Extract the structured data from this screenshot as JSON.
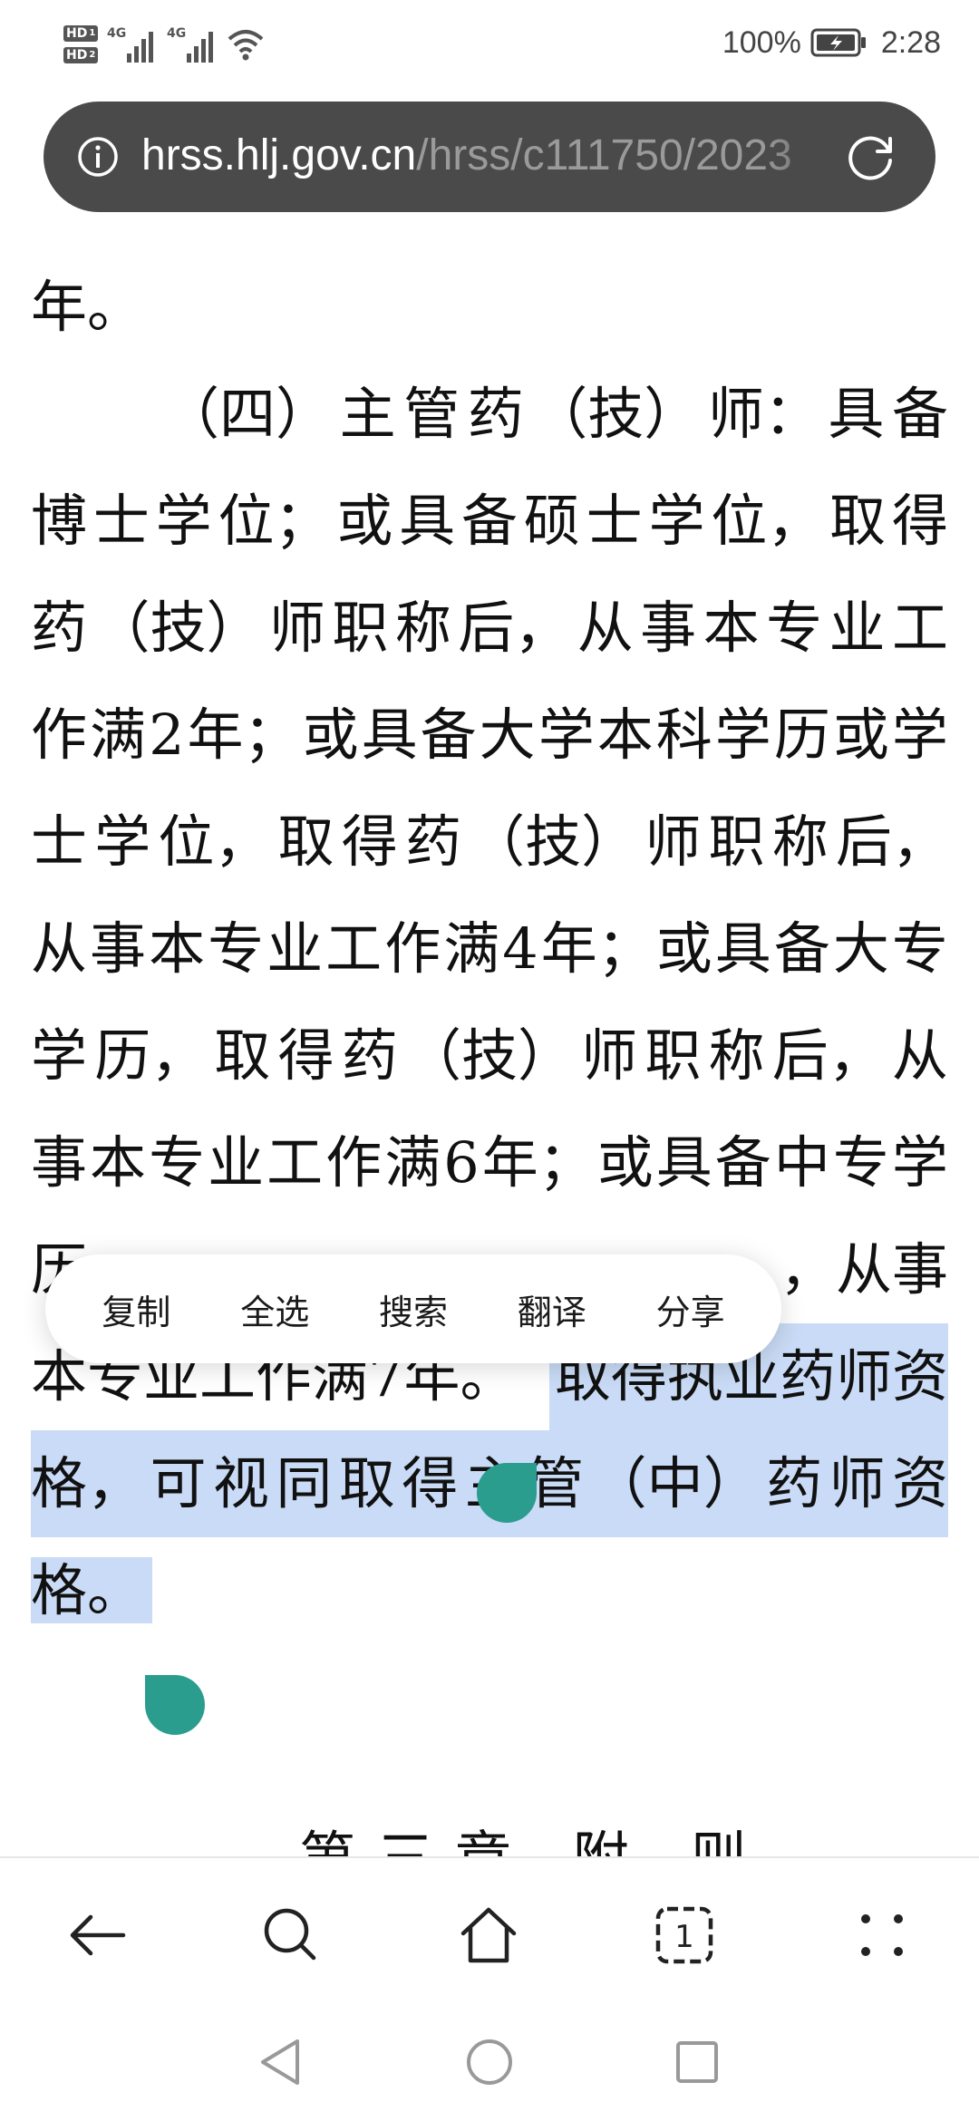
{
  "status_bar": {
    "hd1": "HD",
    "hd1_sub": "1",
    "hd2": "HD",
    "hd2_sub": "2",
    "network1": "4G",
    "network2": "4G",
    "battery_percent": "100%",
    "time": "2:28",
    "icons": [
      "signal-icon",
      "signal-icon",
      "wifi-icon",
      "battery-charging-icon"
    ]
  },
  "url_bar": {
    "domain": "hrss.hlj.gov.cn",
    "path": "/hrss/c111750/2023",
    "icons": [
      "info-icon",
      "reload-icon"
    ]
  },
  "article": {
    "line0": "年。",
    "line1": [
      "（四）",
      "主",
      "管",
      "药",
      "（技）",
      "师：",
      "具",
      "备"
    ],
    "line2": [
      "博",
      "士",
      "学",
      "位；",
      "或",
      "具",
      "备",
      "硕",
      "士",
      "学",
      "位，",
      "取",
      "得"
    ],
    "line3": [
      "药",
      "（技）",
      "师",
      "职",
      "称",
      "后，",
      "从",
      "事",
      "本",
      "专",
      "业",
      "工"
    ],
    "line4": [
      "作",
      "满",
      "2",
      "年；",
      "或",
      "具",
      "备",
      "大",
      "学",
      "本",
      "科",
      "学",
      "历",
      "或",
      "学"
    ],
    "line5": [
      "士",
      "学",
      "位，",
      "取",
      "得",
      "药",
      "（技）",
      "师",
      "职",
      "称",
      "后，"
    ],
    "line6": [
      "从",
      "事",
      "本",
      "专",
      "业",
      "工",
      "作",
      "满",
      "4",
      "年；",
      "或",
      "具",
      "备",
      "大",
      "专"
    ],
    "line7": [
      "学",
      "历，",
      "取",
      "得",
      "药",
      "（技）",
      "师",
      "职",
      "称",
      "后，",
      "从"
    ],
    "line8": [
      "事",
      "本",
      "专",
      "业",
      "工",
      "作",
      "满",
      "6",
      "年；",
      "或",
      "具",
      "备",
      "中",
      "专",
      "学"
    ],
    "line9_start": "历",
    "line9_end": "，从事",
    "line10_plain": "本专业工作满7年。",
    "line10_selected": "取得执业药师资",
    "line11_selected": [
      "格，",
      "可",
      "视",
      "同",
      "取",
      "得",
      "主",
      "管",
      "（中）",
      "药",
      "师",
      "资"
    ],
    "line12_selected": "格。",
    "next_heading": "第三章 附 则"
  },
  "selection_menu": {
    "copy": "复制",
    "select_all": "全选",
    "search": "搜索",
    "translate": "翻译",
    "share": "分享"
  },
  "toolbar": {
    "tab_count": "1",
    "icons": [
      "back-arrow-icon",
      "search-icon",
      "home-icon",
      "tabs-icon",
      "more-icon"
    ]
  },
  "system_nav": {
    "icons": [
      "nav-back-icon",
      "nav-home-icon",
      "nav-recents-icon"
    ]
  },
  "colors": {
    "url_bar_bg": "#4a4a4a",
    "selection_highlight": "#c9dbf6",
    "selection_handle": "#2a9d8f"
  }
}
